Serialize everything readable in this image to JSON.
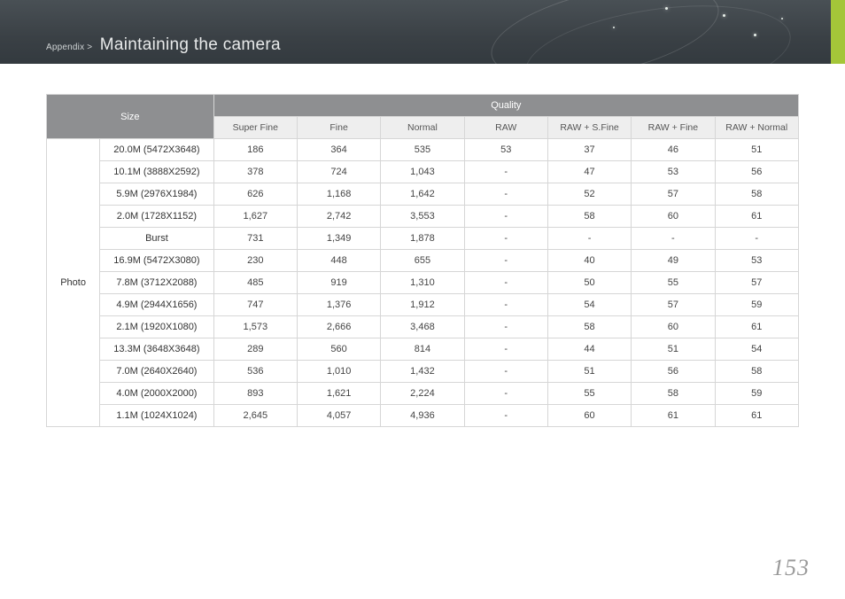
{
  "breadcrumb": {
    "prefix": "Appendix >",
    "title": "Maintaining the camera"
  },
  "page_number": "153",
  "table": {
    "size_header": "Size",
    "quality_header": "Quality",
    "category_label": "Photo",
    "quality_columns": [
      "Super Fine",
      "Fine",
      "Normal",
      "RAW",
      "RAW + S.Fine",
      "RAW + Fine",
      "RAW + Normal"
    ],
    "rows": [
      {
        "size": "20.0M (5472X3648)",
        "v": [
          "186",
          "364",
          "535",
          "53",
          "37",
          "46",
          "51"
        ]
      },
      {
        "size": "10.1M (3888X2592)",
        "v": [
          "378",
          "724",
          "1,043",
          "-",
          "47",
          "53",
          "56"
        ]
      },
      {
        "size": "5.9M (2976X1984)",
        "v": [
          "626",
          "1,168",
          "1,642",
          "-",
          "52",
          "57",
          "58"
        ]
      },
      {
        "size": "2.0M (1728X1152)",
        "v": [
          "1,627",
          "2,742",
          "3,553",
          "-",
          "58",
          "60",
          "61"
        ]
      },
      {
        "size": "Burst",
        "v": [
          "731",
          "1,349",
          "1,878",
          "-",
          "-",
          "-",
          "-"
        ]
      },
      {
        "size": "16.9M (5472X3080)",
        "v": [
          "230",
          "448",
          "655",
          "-",
          "40",
          "49",
          "53"
        ]
      },
      {
        "size": "7.8M (3712X2088)",
        "v": [
          "485",
          "919",
          "1,310",
          "-",
          "50",
          "55",
          "57"
        ]
      },
      {
        "size": "4.9M (2944X1656)",
        "v": [
          "747",
          "1,376",
          "1,912",
          "-",
          "54",
          "57",
          "59"
        ]
      },
      {
        "size": "2.1M (1920X1080)",
        "v": [
          "1,573",
          "2,666",
          "3,468",
          "-",
          "58",
          "60",
          "61"
        ]
      },
      {
        "size": "13.3M (3648X3648)",
        "v": [
          "289",
          "560",
          "814",
          "-",
          "44",
          "51",
          "54"
        ]
      },
      {
        "size": "7.0M (2640X2640)",
        "v": [
          "536",
          "1,010",
          "1,432",
          "-",
          "51",
          "56",
          "58"
        ]
      },
      {
        "size": "4.0M (2000X2000)",
        "v": [
          "893",
          "1,621",
          "2,224",
          "-",
          "55",
          "58",
          "59"
        ]
      },
      {
        "size": "1.1M (1024X1024)",
        "v": [
          "2,645",
          "4,057",
          "4,936",
          "-",
          "60",
          "61",
          "61"
        ]
      }
    ]
  }
}
